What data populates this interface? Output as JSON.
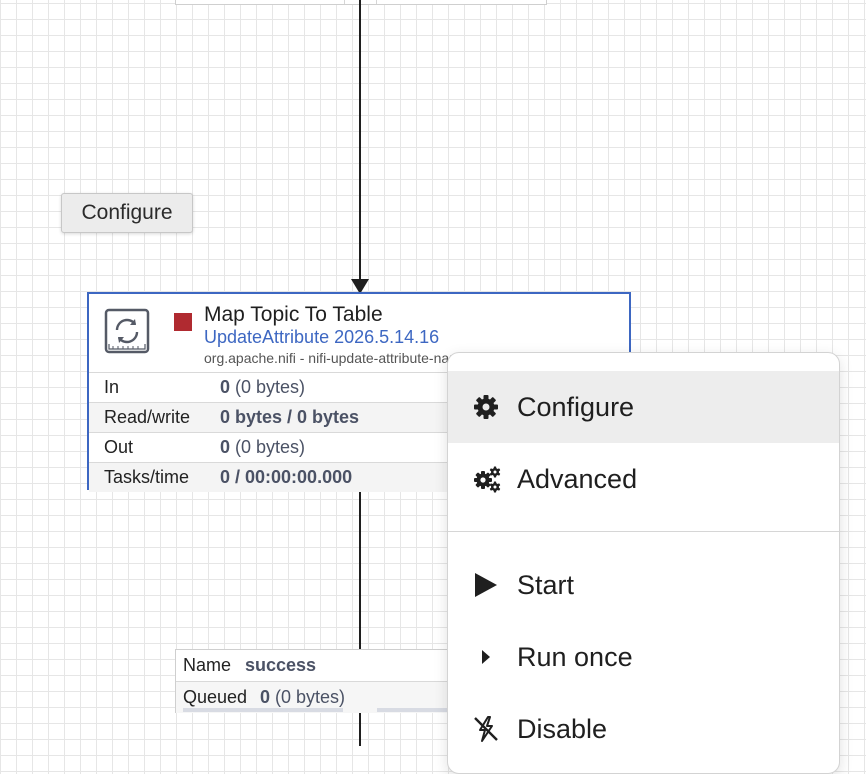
{
  "tooltip": {
    "text": "Configure"
  },
  "processor": {
    "name": "Map Topic To Table",
    "type": "UpdateAttribute 2026.5.14.16",
    "bundle": "org.apache.nifi - nifi-update-attribute-nar",
    "state": "stopped",
    "state_color": "#b02a30",
    "border_color": "#3d67c2",
    "icon": "processor-icon",
    "stats": [
      {
        "label": "In",
        "value_bold": "0",
        "value_rest": " (0 bytes)"
      },
      {
        "label": "Read/write",
        "value_bold": "0 bytes / 0 bytes",
        "value_rest": ""
      },
      {
        "label": "Out",
        "value_bold": "0",
        "value_rest": " (0 bytes)"
      },
      {
        "label": "Tasks/time",
        "value_bold": "0 / 00:00:00.000",
        "value_rest": ""
      }
    ]
  },
  "connection": {
    "name_label": "Name",
    "name_value": "success",
    "queued_label": "Queued",
    "queued_count": "0",
    "queued_size": " (0 bytes)"
  },
  "context_menu": {
    "items": [
      {
        "label": "Configure",
        "icon": "gear-icon"
      },
      {
        "label": "Advanced",
        "icon": "gears-icon"
      },
      {
        "label": "Start",
        "icon": "play-icon"
      },
      {
        "label": "Run once",
        "icon": "caret-right-icon"
      },
      {
        "label": "Disable",
        "icon": "flash-off-icon"
      }
    ]
  }
}
